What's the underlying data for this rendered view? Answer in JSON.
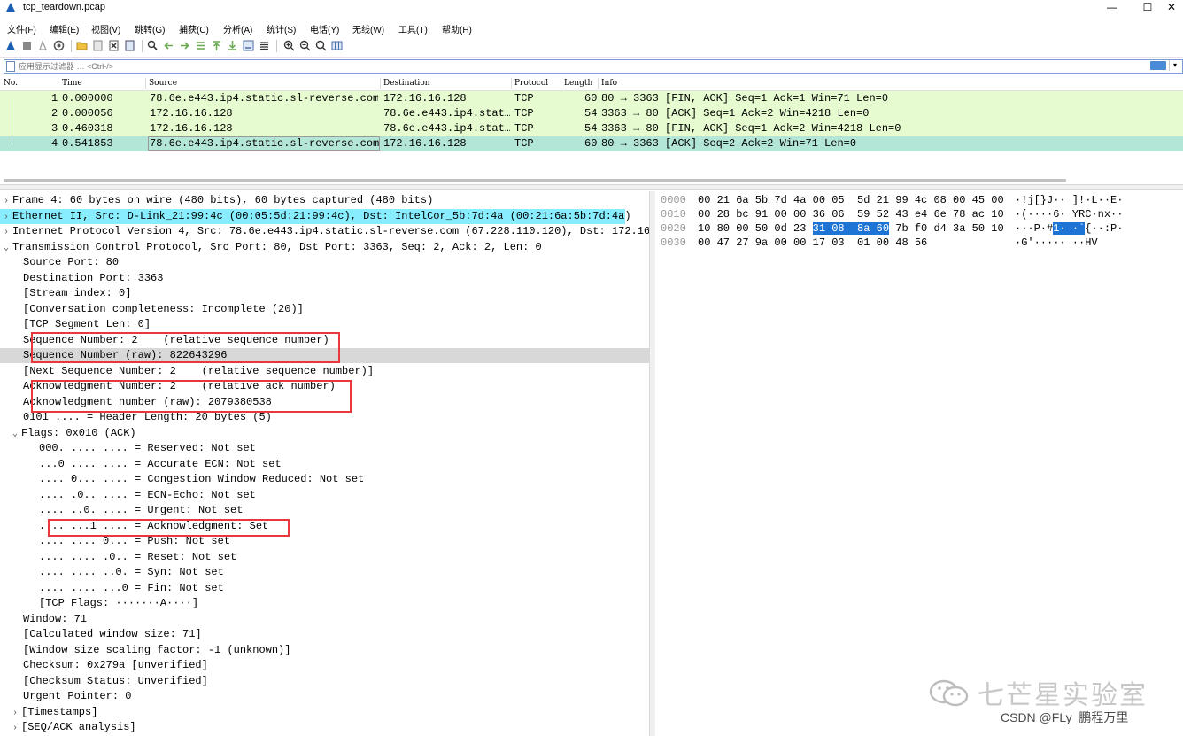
{
  "window": {
    "title": "tcp_teardown.pcap",
    "minimize": "—",
    "maximize": "☐",
    "close": "✕"
  },
  "menu": [
    "文件(F)",
    "编辑(E)",
    "视图(V)",
    "跳转(G)",
    "捕获(C)",
    "分析(A)",
    "统计(S)",
    "电话(Y)",
    "无线(W)",
    "工具(T)",
    "帮助(H)"
  ],
  "filter": {
    "placeholder": "应用显示过滤器 … <Ctrl-/>"
  },
  "packet_list": {
    "columns": [
      "No.",
      "Time",
      "Source",
      "Destination",
      "Protocol",
      "Length",
      "Info"
    ],
    "rows": [
      {
        "no": "1",
        "time": "0.000000",
        "source": "78.6e.e443.ip4.static.sl-reverse.com",
        "destination": "172.16.16.128",
        "protocol": "TCP",
        "length": "60",
        "info": "80 → 3363 [FIN, ACK] Seq=1 Ack=1 Win=71 Len=0"
      },
      {
        "no": "2",
        "time": "0.000056",
        "source": "172.16.16.128",
        "destination": "78.6e.e443.ip4.stat…",
        "protocol": "TCP",
        "length": "54",
        "info": "3363 → 80 [ACK] Seq=1 Ack=2 Win=4218 Len=0"
      },
      {
        "no": "3",
        "time": "0.460318",
        "source": "172.16.16.128",
        "destination": "78.6e.e443.ip4.stat…",
        "protocol": "TCP",
        "length": "54",
        "info": "3363 → 80 [FIN, ACK] Seq=1 Ack=2 Win=4218 Len=0"
      },
      {
        "no": "4",
        "time": "0.541853",
        "source": "78.6e.e443.ip4.static.sl-reverse.com",
        "destination": "172.16.16.128",
        "protocol": "TCP",
        "length": "60",
        "info": "80 → 3363 [ACK] Seq=2 Ack=2 Win=71 Len=0"
      }
    ]
  },
  "details": {
    "lines": [
      {
        "indent": 0,
        "arrow": "›",
        "text": "Frame 4: 60 bytes on wire (480 bits), 60 bytes captured (480 bits)"
      },
      {
        "indent": 0,
        "arrow": "›",
        "text": "Ethernet II, Src: D-Link_21:99:4c (00:05:5d:21:99:4c), Dst: IntelCor_5b:7d:4a (00:21:6a:5b:7d:4a)"
      },
      {
        "indent": 0,
        "arrow": "›",
        "text": "Internet Protocol Version 4, Src: 78.6e.e443.ip4.static.sl-reverse.com (67.228.110.120), Dst: 172.16."
      },
      {
        "indent": 0,
        "arrow": "⌄",
        "text": "Transmission Control Protocol, Src Port: 80, Dst Port: 3363, Seq: 2, Ack: 2, Len: 0"
      },
      {
        "indent": 1,
        "arrow": "",
        "text": "Source Port: 80"
      },
      {
        "indent": 1,
        "arrow": "",
        "text": "Destination Port: 3363"
      },
      {
        "indent": 1,
        "arrow": "",
        "text": "[Stream index: 0]"
      },
      {
        "indent": 1,
        "arrow": "",
        "text": "[Conversation completeness: Incomplete (20)]"
      },
      {
        "indent": 1,
        "arrow": "",
        "text": "[TCP Segment Len: 0]"
      },
      {
        "indent": 1,
        "arrow": "",
        "text": "Sequence Number: 2    (relative sequence number)"
      },
      {
        "indent": 1,
        "arrow": "",
        "text": "Sequence Number (raw): 822643296"
      },
      {
        "indent": 1,
        "arrow": "",
        "text": "[Next Sequence Number: 2    (relative sequence number)]"
      },
      {
        "indent": 1,
        "arrow": "",
        "text": "Acknowledgment Number: 2    (relative ack number)"
      },
      {
        "indent": 1,
        "arrow": "",
        "text": "Acknowledgment number (raw): 2079380538"
      },
      {
        "indent": 1,
        "arrow": "",
        "text": "0101 .... = Header Length: 20 bytes (5)"
      },
      {
        "indent": 1,
        "arrow": "⌄",
        "text": "Flags: 0x010 (ACK)"
      },
      {
        "indent": 2,
        "arrow": "",
        "text": "000. .... .... = Reserved: Not set"
      },
      {
        "indent": 2,
        "arrow": "",
        "text": "...0 .... .... = Accurate ECN: Not set"
      },
      {
        "indent": 2,
        "arrow": "",
        "text": ".... 0... .... = Congestion Window Reduced: Not set"
      },
      {
        "indent": 2,
        "arrow": "",
        "text": ".... .0.. .... = ECN-Echo: Not set"
      },
      {
        "indent": 2,
        "arrow": "",
        "text": ".... ..0. .... = Urgent: Not set"
      },
      {
        "indent": 2,
        "arrow": "",
        "text": ".... ...1 .... = Acknowledgment: Set"
      },
      {
        "indent": 2,
        "arrow": "",
        "text": ".... .... 0... = Push: Not set"
      },
      {
        "indent": 2,
        "arrow": "",
        "text": ".... .... .0.. = Reset: Not set"
      },
      {
        "indent": 2,
        "arrow": "",
        "text": ".... .... ..0. = Syn: Not set"
      },
      {
        "indent": 2,
        "arrow": "",
        "text": ".... .... ...0 = Fin: Not set"
      },
      {
        "indent": 2,
        "arrow": "",
        "text": "[TCP Flags: ·······A····]"
      },
      {
        "indent": 1,
        "arrow": "",
        "text": "Window: 71"
      },
      {
        "indent": 1,
        "arrow": "",
        "text": "[Calculated window size: 71]"
      },
      {
        "indent": 1,
        "arrow": "",
        "text": "[Window size scaling factor: -1 (unknown)]"
      },
      {
        "indent": 1,
        "arrow": "",
        "text": "Checksum: 0x279a [unverified]"
      },
      {
        "indent": 1,
        "arrow": "",
        "text": "[Checksum Status: Unverified]"
      },
      {
        "indent": 1,
        "arrow": "",
        "text": "Urgent Pointer: 0"
      },
      {
        "indent": 1,
        "arrow": "›",
        "text": "[Timestamps]"
      },
      {
        "indent": 1,
        "arrow": "›",
        "text": "[SEQ/ACK analysis]"
      }
    ]
  },
  "hex": {
    "rows": [
      {
        "offset": "0000",
        "pre": "00 21 6a 5b 7d 4a 00 05  5d 21 99 4c 08 00 45 00",
        "hl": "",
        "post": "",
        "ascii_pre": "·!j[}J·· ]!·L··E·",
        "ascii_hl": "",
        "ascii_post": ""
      },
      {
        "offset": "0010",
        "pre": "00 28 bc 91 00 00 36 06  59 52 43 e4 6e 78 ac 10",
        "hl": "",
        "post": "",
        "ascii_pre": "·(····6· YRC·nx··",
        "ascii_hl": "",
        "ascii_post": ""
      },
      {
        "offset": "0020",
        "pre": "10 80 00 50 0d 23 ",
        "hl": "31 08  8a 60",
        "post": " 7b f0 d4 3a 50 10",
        "ascii_pre": "···P·#",
        "ascii_hl": "1· ·`",
        "ascii_post": "{··:P·"
      },
      {
        "offset": "0030",
        "pre": "00 47 27 9a 00 00 17 03  01 00 48 56",
        "hl": "",
        "post": "",
        "ascii_pre": "·G'····· ··HV",
        "ascii_hl": "",
        "ascii_post": ""
      }
    ]
  },
  "watermark": {
    "brand": "七芒星实验室",
    "credit": "CSDN @FLy_鹏程万里"
  },
  "colors": {
    "tcp_row": "#e7fbd0",
    "selected_row": "#b4e6d7",
    "eth_highlight": "#88eeff",
    "hex_highlight": "#1e74d4",
    "annotation_box": "#e8383d"
  }
}
